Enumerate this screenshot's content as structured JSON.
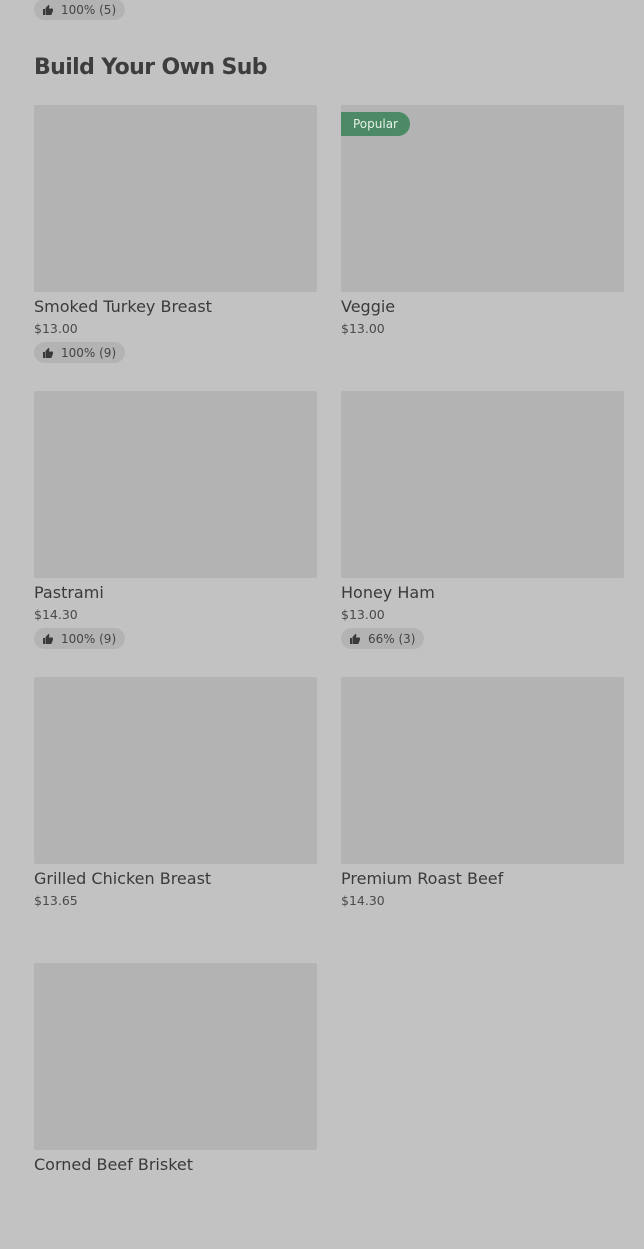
{
  "top_rating": {
    "text": "100% (5)"
  },
  "section": {
    "title": "Build Your Own Sub"
  },
  "colors": {
    "background": "#c2c2c2",
    "image_placeholder": "#b3b3b3",
    "badge_green": "#4b8a64"
  },
  "items": [
    {
      "name": "Smoked Turkey Breast",
      "price": "$13.00",
      "badge": "",
      "rating": "100% (9)"
    },
    {
      "name": "Veggie",
      "price": "$13.00",
      "badge": "Popular",
      "rating": ""
    },
    {
      "name": "Pastrami",
      "price": "$14.30",
      "badge": "",
      "rating": "100% (9)"
    },
    {
      "name": "Honey Ham",
      "price": "$13.00",
      "badge": "",
      "rating": "66% (3)"
    },
    {
      "name": "Grilled Chicken Breast",
      "price": "$13.65",
      "badge": "",
      "rating": ""
    },
    {
      "name": "Premium Roast Beef",
      "price": "$14.30",
      "badge": "",
      "rating": ""
    },
    {
      "name": "Corned Beef Brisket",
      "price": "",
      "badge": "",
      "rating": ""
    }
  ],
  "icons": {
    "rating": "thumbs-up-icon"
  }
}
